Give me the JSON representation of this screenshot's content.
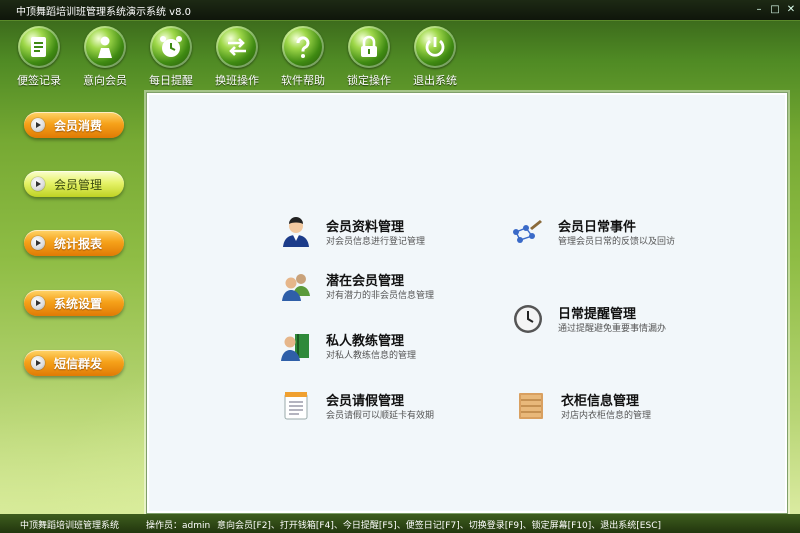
{
  "window": {
    "title": "中顶舞蹈培训班管理系统演示系统  v8.0",
    "controls": {
      "minimize": "–",
      "maximize": "□",
      "close": "✕"
    }
  },
  "toolbar": {
    "items": [
      {
        "label": "便签记录",
        "icon": "notepad-icon"
      },
      {
        "label": "意向会员",
        "icon": "person-icon"
      },
      {
        "label": "每日提醒",
        "icon": "alarm-clock-icon"
      },
      {
        "label": "换班操作",
        "icon": "swap-arrows-icon"
      },
      {
        "label": "软件帮助",
        "icon": "help-icon"
      },
      {
        "label": "锁定操作",
        "icon": "lock-icon"
      },
      {
        "label": "退出系统",
        "icon": "power-icon"
      }
    ]
  },
  "sidebar": {
    "items": [
      {
        "label": "会员消费",
        "active": false
      },
      {
        "label": "会员管理",
        "active": true
      },
      {
        "label": "统计报表",
        "active": false
      },
      {
        "label": "系统设置",
        "active": false
      },
      {
        "label": "短信群发",
        "active": false
      }
    ]
  },
  "main": {
    "items": [
      {
        "title": "会员资料管理",
        "desc": "对会员信息进行登记管理",
        "icon": "member-avatar-icon"
      },
      {
        "title": "潜在会员管理",
        "desc": "对有潜力的非会员信息管理",
        "icon": "users-group-icon"
      },
      {
        "title": "私人教练管理",
        "desc": "对私人教练信息的管理",
        "icon": "trainer-book-icon"
      },
      {
        "title": "会员请假管理",
        "desc": "会员请假可以顺延卡有效期",
        "icon": "notepad-list-icon"
      },
      {
        "title": "会员日常事件",
        "desc": "管理会员日常的反馈以及回访",
        "icon": "network-pen-icon"
      },
      {
        "title": "日常提醒管理",
        "desc": "通过提醒避免重要事情漏办",
        "icon": "wall-clock-icon"
      },
      {
        "title": "衣柜信息管理",
        "desc": "对店内衣柜信息的管理",
        "icon": "locker-cabinet-icon"
      }
    ]
  },
  "statusbar": {
    "app_name": "中顶舞蹈培训班管理系统",
    "operator": "操作员：admin",
    "shortcuts": "意向会员[F2]、打开钱箱[F4]、今日提醒[F5]、便签日记[F7]、切换登录[F9]、锁定屏幕[F10]、退出系统[ESC]"
  },
  "colors": {
    "accent_orange": "#f6a21a",
    "active_lime": "#e6f36a",
    "panel_bg": "#f2f7fa",
    "title_bar": "#0f160b"
  }
}
